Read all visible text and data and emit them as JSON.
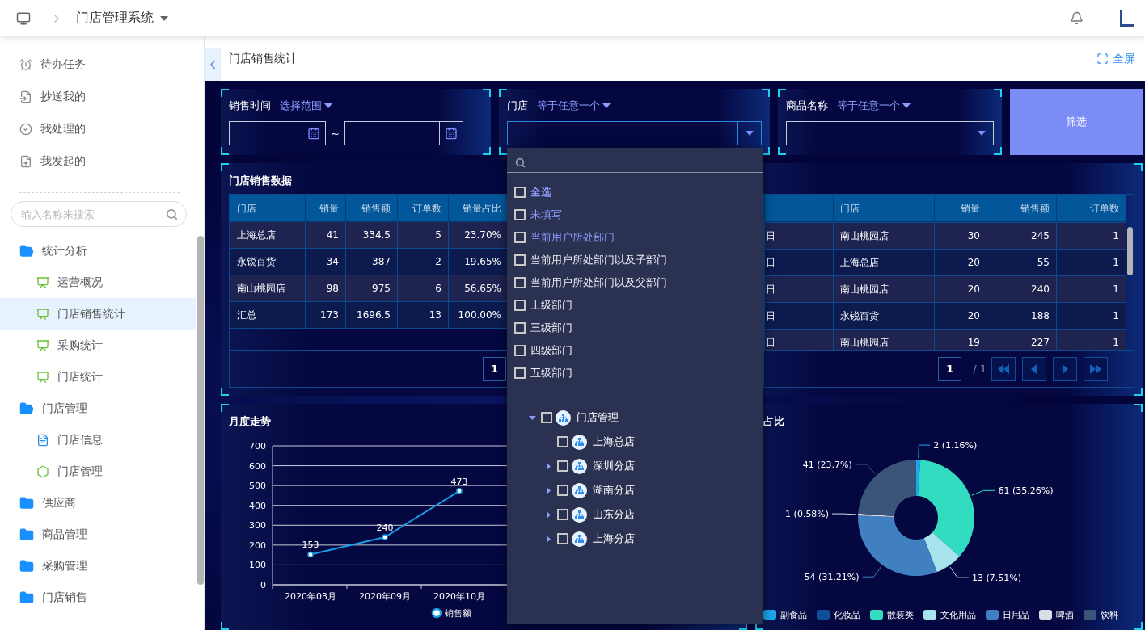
{
  "header": {
    "title": "门店管理系统"
  },
  "sidebar": {
    "quick_links": [
      {
        "label": "待办任务",
        "kind": "todo"
      },
      {
        "label": "抄送我的",
        "kind": "cc"
      },
      {
        "label": "我处理的",
        "kind": "done"
      },
      {
        "label": "我发起的",
        "kind": "started"
      }
    ],
    "search": {
      "placeholder": "输入名称来搜索"
    },
    "tree": [
      {
        "label": "统计分析",
        "expanded": true,
        "children": [
          {
            "label": "运营概况",
            "kind": "report",
            "selected": false
          },
          {
            "label": "门店销售统计",
            "kind": "report",
            "selected": true
          },
          {
            "label": "采购统计",
            "kind": "report",
            "selected": false
          },
          {
            "label": "门店统计",
            "kind": "report",
            "selected": false
          }
        ]
      },
      {
        "label": "门店管理",
        "expanded": true,
        "children": [
          {
            "label": "门店信息",
            "kind": "document",
            "selected": false
          },
          {
            "label": "门店管理",
            "kind": "settings",
            "selected": false
          }
        ]
      },
      {
        "label": "供应商",
        "expanded": false
      },
      {
        "label": "商品管理",
        "expanded": false
      },
      {
        "label": "采购管理",
        "expanded": false
      },
      {
        "label": "门店销售",
        "expanded": false
      }
    ]
  },
  "page": {
    "title": "门店销售统计",
    "fullscreen": "全屏"
  },
  "filters": [
    {
      "label": "销售时间",
      "mode": "选择范围",
      "kind": "date_range",
      "separator": "~"
    },
    {
      "label": "门店",
      "mode": "等于任意一个",
      "kind": "select",
      "focused": true
    },
    {
      "label": "商品名称",
      "mode": "等于任意一个",
      "kind": "select",
      "focused": false
    }
  ],
  "filter_button": "筛选",
  "sales_table": {
    "title": "门店销售数据",
    "columns": [
      "门店",
      "销量",
      "销售额",
      "订单数",
      "销量占比"
    ],
    "rows": [
      [
        "上海总店",
        "41",
        "334.5",
        "5",
        "23.70%"
      ],
      [
        "永锐百货",
        "34",
        "387",
        "2",
        "19.65%"
      ],
      [
        "南山桃园店",
        "98",
        "975",
        "6",
        "56.65%"
      ],
      [
        "汇总",
        "173",
        "1696.5",
        "13",
        "100.00%"
      ]
    ],
    "page": "1"
  },
  "detail_table": {
    "columns": [
      "门店",
      "销量",
      "销售额",
      "订单数"
    ],
    "rows": [
      {
        "column_1": "日",
        "cells": [
          "南山桃园店",
          "30",
          "245",
          "1"
        ]
      },
      {
        "column_1": "日",
        "cells": [
          "上海总店",
          "20",
          "55",
          "1"
        ]
      },
      {
        "column_1": "日",
        "cells": [
          "南山桃园店",
          "20",
          "240",
          "1"
        ]
      },
      {
        "column_1": "日",
        "cells": [
          "永锐百货",
          "20",
          "188",
          "1"
        ]
      },
      {
        "column_1": "日",
        "cells": [
          "南山桃园店",
          "19",
          "227",
          "1"
        ]
      }
    ],
    "page": "1",
    "page_total": "/ 1"
  },
  "trend_chart": {
    "title": "月度走势",
    "chart_data": {
      "type": "line",
      "categories": [
        "2020年03月",
        "2020年09月",
        "2020年10月"
      ],
      "series": [
        {
          "name": "销售额",
          "color": "#1a9be6",
          "marker": true,
          "values": [
            153,
            240,
            473
          ]
        }
      ],
      "grid": true,
      "ylim": [
        0,
        700
      ],
      "yticks": [
        0,
        100,
        200,
        300,
        400,
        500,
        600,
        700
      ],
      "data_labels": true
    }
  },
  "share_chart": {
    "title": "占比",
    "chart_data": {
      "type": "donut",
      "categories": [
        "副食品",
        "化妆品",
        "散装类",
        "文化用品",
        "日用品",
        "啤酒",
        "饮料"
      ],
      "values": [
        2,
        null,
        61,
        13,
        54,
        1,
        41
      ],
      "colors": [
        "#1aa7ee",
        "#0d4f96",
        "#31dcc0",
        "#a6e3ec",
        "#4080c0",
        "#d8dde6",
        "#3a5577"
      ],
      "value_labels": [
        "2 (1.16%)",
        null,
        "61 (35.26%)",
        "13 (7.51%)",
        "54 (31.21%)",
        "1 (0.58%)",
        "41 (23.7%)"
      ]
    }
  },
  "dropdown": {
    "options": [
      {
        "label": "全选",
        "kind": "all",
        "checked": false
      },
      {
        "label": "未填写",
        "kind": "special",
        "checked": false
      },
      {
        "label": "当前用户所处部门",
        "kind": "special",
        "checked": false
      },
      {
        "label": "当前用户所处部门以及子部门",
        "kind": "department",
        "checked": false
      },
      {
        "label": "当前用户所处部门以及父部门",
        "kind": "department",
        "checked": false
      },
      {
        "label": "上级部门",
        "kind": "department",
        "checked": false
      },
      {
        "label": "三级部门",
        "kind": "department",
        "checked": false
      },
      {
        "label": "四级部门",
        "kind": "department",
        "checked": false
      },
      {
        "label": "五级部门",
        "kind": "department",
        "checked": false
      }
    ],
    "tree": [
      {
        "label": "门店管理",
        "expanded": true,
        "checked": false,
        "children": [
          {
            "label": "上海总店",
            "checked": false
          },
          {
            "label": "深圳分店",
            "expanded": false,
            "checked": false
          },
          {
            "label": "湖南分店",
            "expanded": false,
            "checked": false
          },
          {
            "label": "山东分店",
            "expanded": false,
            "checked": false
          },
          {
            "label": "上海分店",
            "expanded": false,
            "checked": false
          }
        ]
      }
    ]
  }
}
